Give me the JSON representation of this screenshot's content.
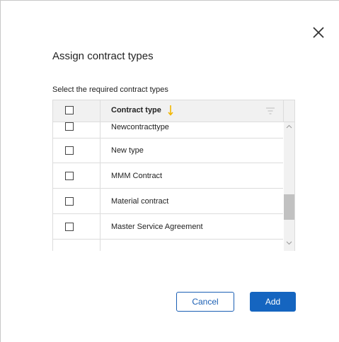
{
  "dialog": {
    "title": "Assign contract types",
    "subtitle": "Select the required contract types"
  },
  "table": {
    "column_header": "Contract type",
    "sort_indicator_color": "#f2b600",
    "rows": [
      {
        "label": "Newcontracttype",
        "checked": false
      },
      {
        "label": "New type",
        "checked": false
      },
      {
        "label": "MMM Contract",
        "checked": false
      },
      {
        "label": "Material contract",
        "checked": false
      },
      {
        "label": "Master Service Agreement",
        "checked": false
      }
    ]
  },
  "buttons": {
    "cancel": "Cancel",
    "add": "Add"
  },
  "colors": {
    "primary": "#1565c0",
    "header_bg": "#f1f1f1",
    "border": "#dcdcdc"
  },
  "icons": {
    "close": "close-icon",
    "sort": "arrow-down-icon",
    "filter": "filter-icon"
  }
}
